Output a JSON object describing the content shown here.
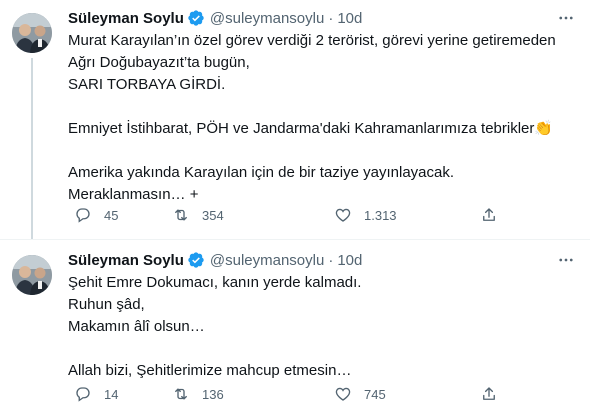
{
  "tweets": [
    {
      "author": {
        "name": "Süleyman Soylu",
        "handle": "@suleymansoylu",
        "verified": true
      },
      "time": "10d",
      "lines": [
        "Murat Karayılan’ın özel görev verdiği 2 terörist, görevi yerine getiremeden",
        "Ağrı Doğubayazıt’ta bugün,",
        "SARI TORBAYA GİRDİ.",
        "",
        "Emniyet İstihbarat, PÖH ve Jandarma'daki Kahramanlarımıza tebrikler",
        "",
        "Amerika yakında Karayılan için de bir taziye yayınlayacak.",
        "Meraklanmasın… +"
      ],
      "emoji": "👏",
      "stats": {
        "replies": "45",
        "retweets": "354",
        "likes": "1.313"
      }
    },
    {
      "author": {
        "name": "Süleyman Soylu",
        "handle": "@suleymansoylu",
        "verified": true
      },
      "time": "10d",
      "lines": [
        "Şehit Emre Dokumacı, kanın yerde kalmadı.",
        "Ruhun şâd,",
        "Makamın âlî olsun…",
        "",
        "Allah bizi, Şehitlerimize mahcup etmesin…"
      ],
      "stats": {
        "replies": "14",
        "retweets": "136",
        "likes": "745"
      }
    }
  ],
  "separator": "·",
  "icons": {
    "verified": "verified-badge-icon",
    "more": "more-icon",
    "reply": "reply-icon",
    "retweet": "retweet-icon",
    "like": "heart-icon",
    "share": "share-icon"
  },
  "colors": {
    "verified": "#1d9bf0",
    "text_primary": "#0f1419",
    "text_secondary": "#536471",
    "thread_line": "#cfd9de"
  }
}
